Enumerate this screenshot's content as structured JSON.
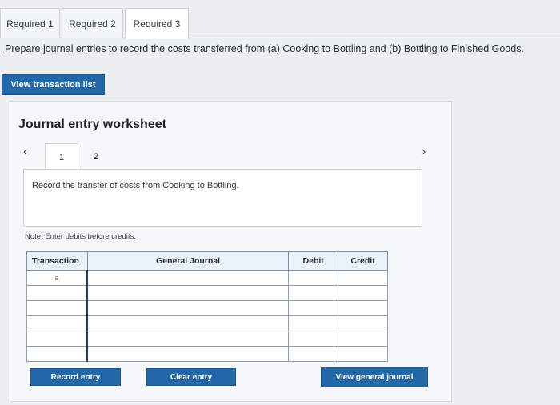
{
  "tabs": [
    {
      "label": "Required 1",
      "active": false
    },
    {
      "label": "Required 2",
      "active": false
    },
    {
      "label": "Required 3",
      "active": true
    }
  ],
  "question": "Prepare journal entries to record the costs transferred from (a) Cooking to Bottling and (b) Bottling to Finished Goods.",
  "view_transaction_list": "View transaction list",
  "worksheet": {
    "title": "Journal entry worksheet",
    "prev_icon": "chevron-left-icon",
    "next_icon": "chevron-right-icon",
    "pages": [
      "1",
      "2"
    ],
    "active_page": "1",
    "instruction": "Record the transfer of costs from Cooking to Bottling.",
    "note": "Note: Enter debits before credits.",
    "table": {
      "headers": [
        "Transaction",
        "General Journal",
        "Debit",
        "Credit"
      ],
      "rows": [
        [
          "a",
          "",
          "",
          ""
        ],
        [
          "",
          "",
          "",
          ""
        ],
        [
          "",
          "",
          "",
          ""
        ],
        [
          "",
          "",
          "",
          ""
        ],
        [
          "",
          "",
          "",
          ""
        ],
        [
          "",
          "",
          "",
          ""
        ]
      ]
    },
    "buttons": {
      "record": "Record entry",
      "clear": "Clear entry",
      "view_journal": "View general journal"
    }
  }
}
